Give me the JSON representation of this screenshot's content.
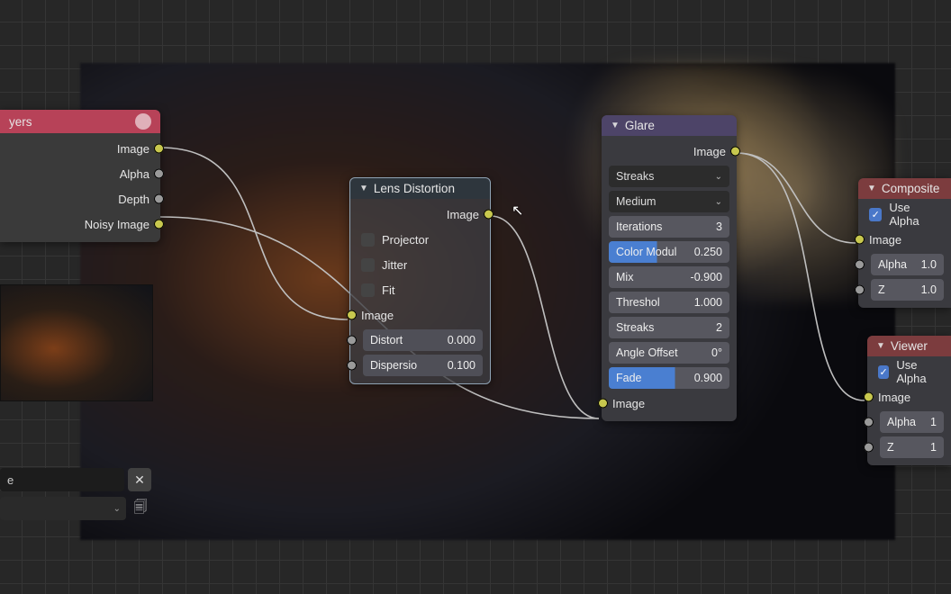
{
  "render_layers": {
    "title": "yers",
    "outputs": [
      "Image",
      "Alpha",
      "Depth",
      "Noisy Image"
    ]
  },
  "lens": {
    "title": "Lens Distortion",
    "output": "Image",
    "checks": {
      "projector": "Projector",
      "jitter": "Jitter",
      "fit": "Fit"
    },
    "input_label": "Image",
    "fields": {
      "distort": {
        "label": "Distort",
        "value": "0.000"
      },
      "dispersion": {
        "label": "Dispersio",
        "value": "0.100"
      }
    }
  },
  "glare": {
    "title": "Glare",
    "output": "Image",
    "type": {
      "value": "Streaks"
    },
    "quality": {
      "value": "Medium"
    },
    "fields": {
      "iterations": {
        "label": "Iterations",
        "value": "3"
      },
      "color_modul": {
        "label": "Color Modul",
        "value": "0.250"
      },
      "mix": {
        "label": "Mix",
        "value": "-0.900"
      },
      "threshold": {
        "label": "Threshol",
        "value": "1.000"
      },
      "streaks": {
        "label": "Streaks",
        "value": "2"
      },
      "angle_offset": {
        "label": "Angle Offset",
        "value": "0°"
      },
      "fade": {
        "label": "Fade",
        "value": "0.900"
      }
    },
    "input_label": "Image"
  },
  "composite": {
    "title": "Composite",
    "use_alpha": "Use Alpha",
    "inputs": {
      "image": {
        "label": "Image"
      },
      "alpha": {
        "label": "Alpha",
        "value": "1.0"
      },
      "z": {
        "label": "Z",
        "value": "1.0"
      }
    }
  },
  "viewer": {
    "title": "Viewer",
    "use_alpha": "Use Alpha",
    "inputs": {
      "image": {
        "label": "Image"
      },
      "alpha": {
        "label": "Alpha",
        "value": "1"
      },
      "z": {
        "label": "Z",
        "value": "1"
      }
    }
  },
  "bottom": {
    "input_value": "e"
  }
}
